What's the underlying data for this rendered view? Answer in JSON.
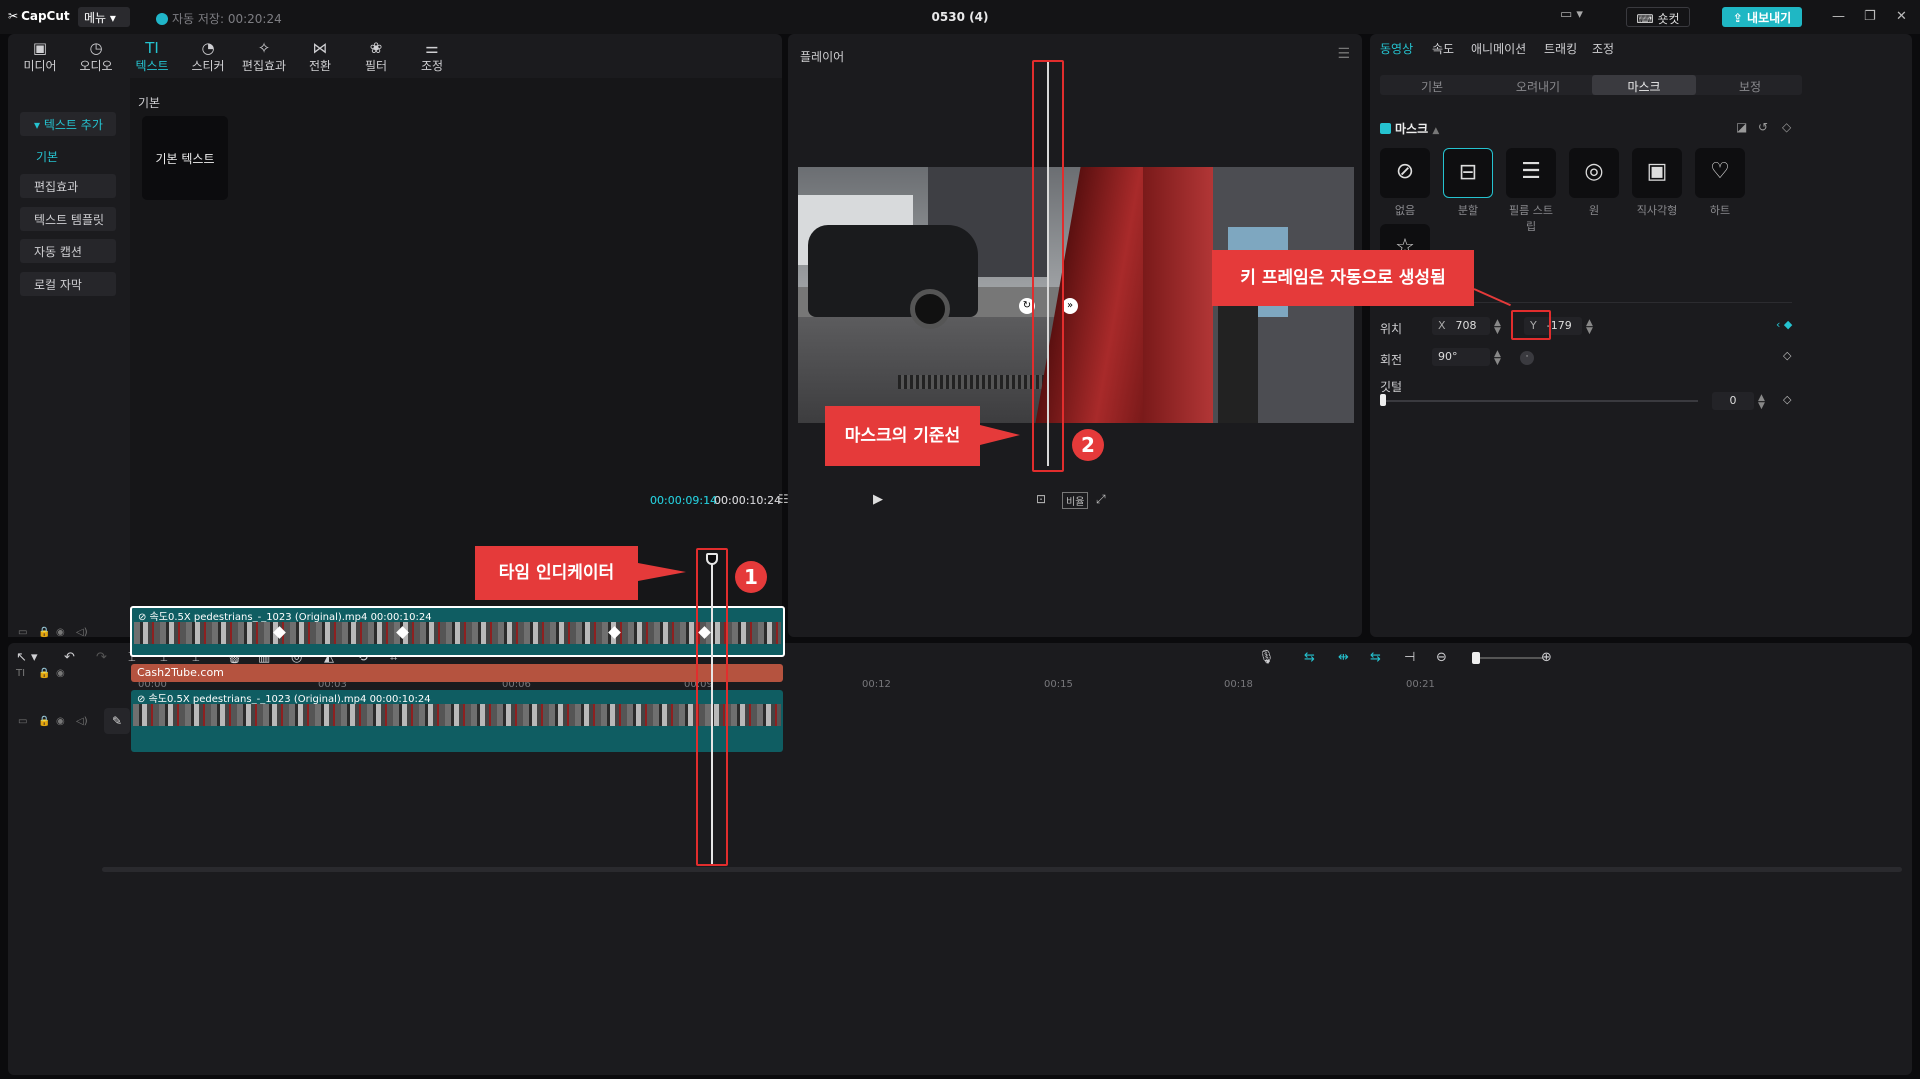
{
  "app": {
    "logo": "CapCut",
    "menu_label": "메뉴",
    "autosave": "자동 저장: 00:20:24",
    "project_title": "0530 (4)",
    "shortcut_label": "숏컷",
    "export_label": "내보내기"
  },
  "toolbar": {
    "items": [
      {
        "label": "미디어",
        "icon": "media-icon"
      },
      {
        "label": "오디오",
        "icon": "audio-icon"
      },
      {
        "label": "텍스트",
        "icon": "text-icon"
      },
      {
        "label": "스티커",
        "icon": "sticker-icon"
      },
      {
        "label": "편집효과",
        "icon": "effects-icon"
      },
      {
        "label": "전환",
        "icon": "transition-icon"
      },
      {
        "label": "필터",
        "icon": "filter-icon"
      },
      {
        "label": "조정",
        "icon": "adjust-icon"
      }
    ]
  },
  "sidebar": {
    "items": [
      "텍스트 추가",
      "기본",
      "편집효과",
      "텍스트 템플릿",
      "자동 캡션",
      "로컬 자막"
    ]
  },
  "media": {
    "section_label": "기본",
    "card_label": "기본 텍스트"
  },
  "player": {
    "title": "플레이어",
    "current_time": "00:00:09:14",
    "total_time": "00:00:10:24",
    "ratio_label": "비율"
  },
  "properties": {
    "tabs": [
      "동영상",
      "속도",
      "애니메이션",
      "트래킹",
      "조정"
    ],
    "sub_tabs": [
      "기본",
      "오려내기",
      "마스크",
      "보정"
    ],
    "mask_title": "마스크",
    "shapes": [
      "없음",
      "분할",
      "필름 스트립",
      "원",
      "직사각형",
      "하트",
      "별"
    ],
    "position_label": "위치",
    "x_prefix": "X",
    "x_value": "708",
    "y_prefix": "Y",
    "y_value": "-179",
    "rotation_label": "회전",
    "rotation_value": "90°",
    "feather_label": "깃털",
    "feather_value": "0"
  },
  "timeline": {
    "ticks": [
      "00:00",
      "00:03",
      "00:06",
      "00:09",
      "00:12",
      "00:15",
      "00:18",
      "00:21"
    ],
    "main_clip": "⊘ 속도0.5X   pedestrians_-_1023 (Original).mp4   00:00:10:24",
    "text_clip": "Cash2Tube.com",
    "sub_clip": "⊘ 속도0.5X   pedestrians_-_1023 (Original).mp4   00:00:10:24"
  },
  "annotations": {
    "time_indicator": "타임 인디케이터",
    "mask_baseline": "마스크의 기준선",
    "keyframe_auto": "키 프레임은 자동으로 생성됨",
    "badge1": "1",
    "badge2": "2"
  },
  "colors": {
    "accent": "#25c3d0",
    "annotation_red": "#e53a3a",
    "text_clip": "#b5533f",
    "video_clip": "#0f5d62"
  }
}
